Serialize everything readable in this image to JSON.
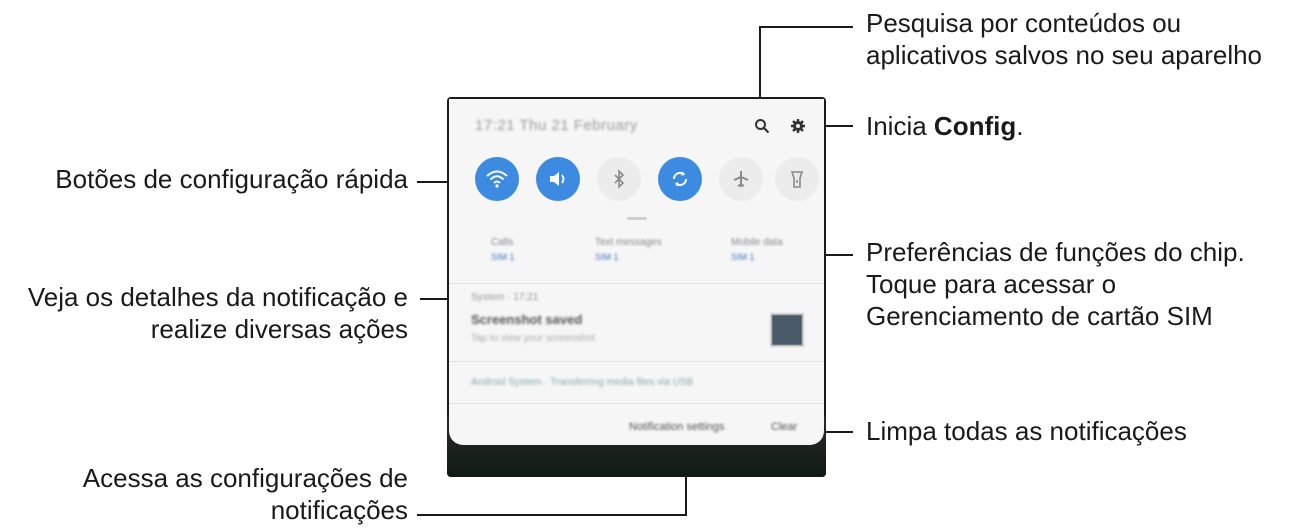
{
  "callouts": {
    "search": [
      "Pesquisa por conteúdos ou",
      "aplicativos salvos no seu aparelho"
    ],
    "settings_prefix": "Inicia ",
    "settings_bold": "Config",
    "settings_suffix": ".",
    "quick_settings": "Botões de configuração rápida",
    "sim": [
      "Preferências de funções do chip.",
      "Toque para acessar o",
      "Gerenciamento de cartão SIM"
    ],
    "notification": [
      "Veja os detalhes da notificação e",
      "realize diversas ações"
    ],
    "clear": "Limpa todas as notificações",
    "notif_settings": [
      "Acessa as configurações de",
      "notificações"
    ]
  },
  "phone": {
    "header_text": "17:21  Thu 21 February",
    "quick_buttons": [
      {
        "icon": "wifi-icon",
        "state": "on"
      },
      {
        "icon": "sound-icon",
        "state": "on"
      },
      {
        "icon": "bluetooth-icon",
        "state": "off"
      },
      {
        "icon": "auto-rotate-icon",
        "state": "on"
      },
      {
        "icon": "airplane-icon",
        "state": "off"
      },
      {
        "icon": "flashlight-icon",
        "state": "off"
      }
    ],
    "sim_items": [
      {
        "label": "Calls",
        "sim": "SIM 1"
      },
      {
        "label": "Text messages",
        "sim": "SIM 1"
      },
      {
        "label": "Mobile data",
        "sim": "SIM 1"
      }
    ],
    "notification": {
      "app": "System · 17:21",
      "title": "Screenshot saved",
      "body": "Tap to view your screenshot"
    },
    "notification2": "Android System · Transferring media files via USB",
    "footer": {
      "settings": "Notification settings",
      "clear": "Clear"
    }
  }
}
